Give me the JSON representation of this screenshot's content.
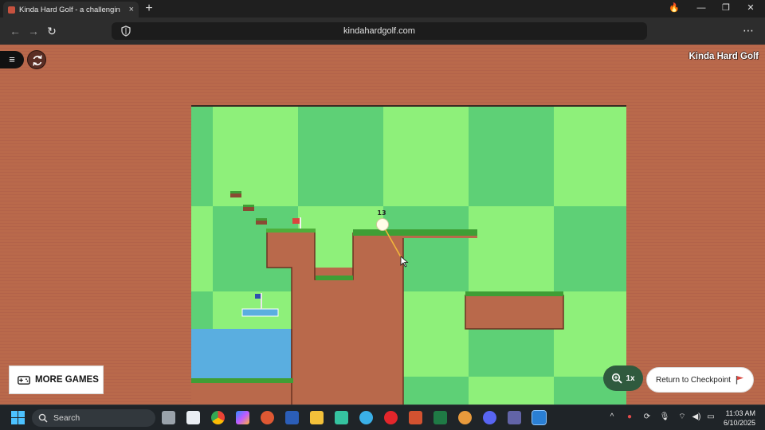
{
  "browser": {
    "tab_title": "Kinda Hard Golf - a challengin",
    "tab_close": "×",
    "new_tab": "+",
    "url": "kindahardgolf.com",
    "menu": "⋯",
    "back": "←",
    "forward": "→",
    "reload": "↻",
    "controls": {
      "fire": "🔥",
      "minimize": "—",
      "restore": "❐",
      "close": "✕"
    }
  },
  "game": {
    "title": "Kinda Hard Golf",
    "menu_icon": "≡",
    "stroke_count": "13",
    "more_games_label": "MORE GAMES",
    "zoom_level": "1x",
    "checkpoint_label": "Return to Checkpoint",
    "colors": {
      "dirt": "#b9694b",
      "grass_light": "#8ef07a",
      "grass_dark": "#5ed076",
      "water": "#5aaee0",
      "flag": "#d9463e",
      "checkpoint_flag": "#2f4fb0",
      "aim_line": "#f2b53b"
    }
  },
  "taskbar": {
    "search_placeholder": "Search",
    "time": "11:03 AM",
    "date": "6/10/2025",
    "tray": {
      "chevron": "^",
      "wifi": "⌔",
      "volume": "◀)",
      "battery": "▭"
    }
  }
}
